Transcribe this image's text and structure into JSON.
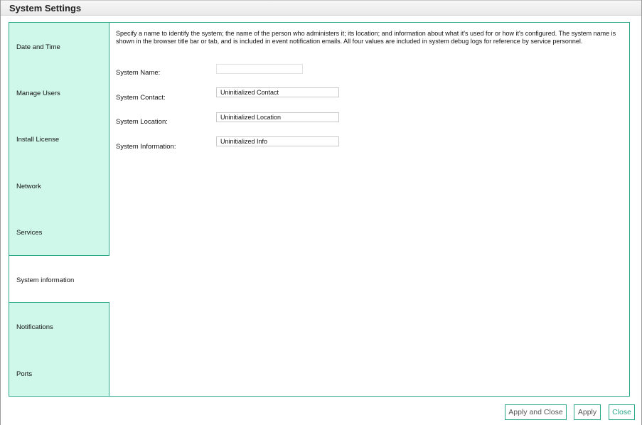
{
  "window": {
    "title": "System Settings"
  },
  "sidebar": {
    "items": [
      {
        "label": "Date and Time"
      },
      {
        "label": "Manage Users"
      },
      {
        "label": "Install License"
      },
      {
        "label": "Network"
      },
      {
        "label": "Services"
      },
      {
        "label": "System information",
        "active": true
      },
      {
        "label": "Notifications"
      },
      {
        "label": "Ports"
      }
    ]
  },
  "content": {
    "description": "Specify a name to identify the system; the name of the person who administers it; its location; and information about what it's used for or how it's configured. The system name is shown in the browser title bar or tab, and is included in event notification emails. All four values are included in system debug logs for reference by service personnel.",
    "fields": {
      "system_name": {
        "label": "System Name:",
        "value": ""
      },
      "system_contact": {
        "label": "System Contact:",
        "value": "Uninitialized Contact"
      },
      "system_location": {
        "label": "System Location:",
        "value": "Uninitialized Location"
      },
      "system_information": {
        "label": "System Information:",
        "value": "Uninitialized Info"
      }
    }
  },
  "buttons": {
    "apply_and_close": "Apply and Close",
    "apply": "Apply",
    "close": "Close"
  },
  "colors": {
    "accent": "#2aa88a",
    "tab_background": "#d0f8ea"
  }
}
